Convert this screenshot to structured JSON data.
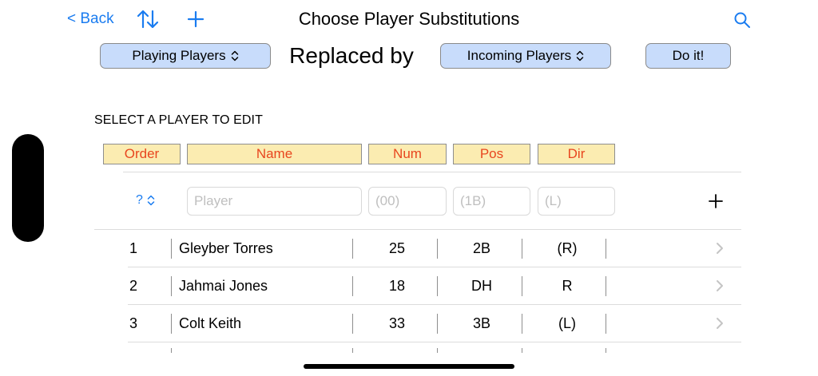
{
  "nav": {
    "back_label": "< Back",
    "title": "Choose Player Substitutions",
    "icons": [
      "sort-arrows-icon",
      "plus-icon",
      "search-icon"
    ]
  },
  "controls": {
    "playing_label": "Playing Players",
    "replaced_label": "Replaced by",
    "incoming_label": "Incoming Players",
    "doit_label": "Do it!",
    "updown_glyph": "⌃⌄"
  },
  "section_label": "SELECT A PLAYER TO EDIT",
  "headers": {
    "order": "Order",
    "name": "Name",
    "num": "Num",
    "pos": "Pos",
    "dir": "Dir"
  },
  "entry": {
    "order_value": "?",
    "player_placeholder": "Player",
    "num_placeholder": "(00)",
    "pos_placeholder": "(1B)",
    "dir_placeholder": "(L)"
  },
  "rows": [
    {
      "order": "1",
      "name": "Gleyber Torres",
      "num": "25",
      "pos": "2B",
      "dir": "(R)"
    },
    {
      "order": "2",
      "name": "Jahmai Jones",
      "num": "18",
      "pos": "DH",
      "dir": "R"
    },
    {
      "order": "3",
      "name": "Colt Keith",
      "num": "33",
      "pos": "3B",
      "dir": "(L)"
    }
  ],
  "colors": {
    "accent": "#1a7cf0",
    "pill_bg": "#c8dcfb",
    "header_bg": "#fbecb1",
    "header_text": "#e8461f"
  }
}
